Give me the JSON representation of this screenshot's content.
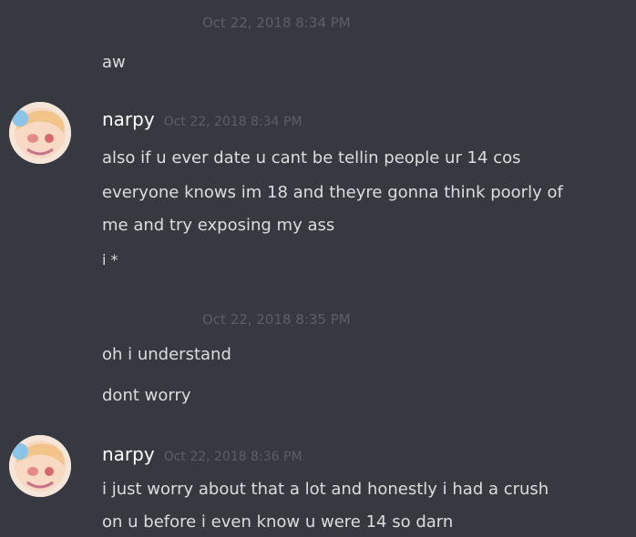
{
  "messages": {
    "ts1": "Oct 22, 2018 8:34 PM",
    "m1": "aw",
    "group1": {
      "author": "narpy",
      "timestamp": "Oct 22, 2018 8:34 PM",
      "lines": [
        "also if u ever date u cant be tellin people ur 14 cos",
        "everyone knows im 18 and theyre gonna think poorly of",
        "me and try exposing my ass",
        "i *"
      ]
    },
    "ts2": "Oct 22, 2018 8:35 PM",
    "m2": "oh i understand",
    "m3": "dont worry",
    "group2": {
      "author": "narpy",
      "timestamp": "Oct 22, 2018 8:36 PM",
      "lines": [
        "i just worry about that a lot and honestly i had a crush",
        "on u before i even know u were 14 so darn"
      ]
    }
  },
  "colors": {
    "background": "#36393f",
    "text": "#dcddde",
    "timestamp": "#5c5f66",
    "author": "#ffffff"
  },
  "icons": {
    "avatar": "anime-character-avatar"
  }
}
